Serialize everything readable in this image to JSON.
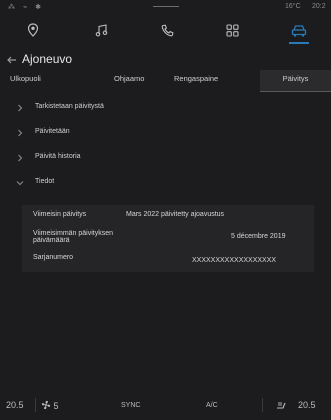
{
  "status": {
    "left_icons": "⁂ ⌁ ✱",
    "temperature": "16°C",
    "time": "20:2"
  },
  "nav": {
    "items": [
      {
        "name": "location-pin-icon"
      },
      {
        "name": "music-icon"
      },
      {
        "name": "phone-icon"
      },
      {
        "name": "apps-grid-icon"
      },
      {
        "name": "car-icon",
        "active": true
      }
    ],
    "accent": "#2a7ab8"
  },
  "header": {
    "title": "Ajoneuvo"
  },
  "tabs": [
    {
      "label": "Ulkopuoli"
    },
    {
      "label": "Ohjaamo"
    },
    {
      "label": "Rengaspaine"
    },
    {
      "label": "Päivitys",
      "active": true
    }
  ],
  "list": [
    {
      "label": "Tarkistetaan päivitystä",
      "expanded": false
    },
    {
      "label": "Päivitetään",
      "expanded": false
    },
    {
      "label": "Päivitä historia",
      "expanded": false
    },
    {
      "label": "Tiedot",
      "expanded": true
    }
  ],
  "details": {
    "latest_update_label": "Viimeisin päivitys",
    "latest_update_value": "Mars 2022 päivitetty ajoavustus",
    "latest_update_date_label_line1": "Viimeisimmän päivityksen",
    "latest_update_date_label_line2": "päivämäärä",
    "latest_update_date_value": "5 décembre 2019",
    "serial_label": "Sarjanumero",
    "serial_value": "XXXXXXXXXXXXXXXXXX"
  },
  "climate": {
    "left_temp": "20.5",
    "fan_speed": "5",
    "sync_label": "SYNC",
    "ac_label": "A/C",
    "right_temp": "20.5"
  }
}
